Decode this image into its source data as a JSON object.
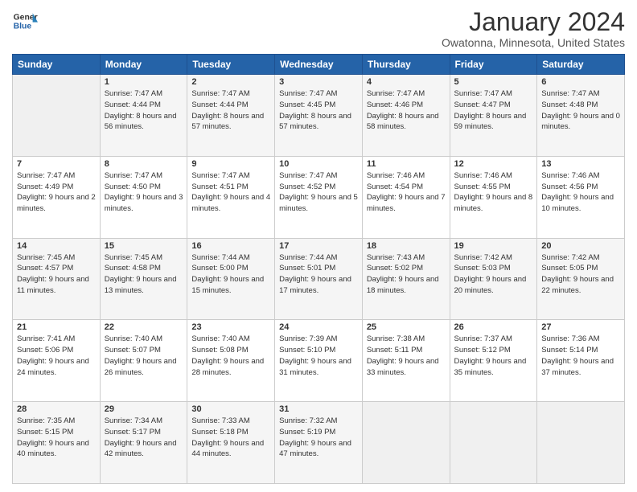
{
  "header": {
    "logo": {
      "general": "General",
      "blue": "Blue",
      "icon_color": "#2563a8"
    },
    "title": "January 2024",
    "subtitle": "Owatonna, Minnesota, United States"
  },
  "calendar": {
    "days_of_week": [
      "Sunday",
      "Monday",
      "Tuesday",
      "Wednesday",
      "Thursday",
      "Friday",
      "Saturday"
    ],
    "weeks": [
      [
        {
          "day": "",
          "sunrise": "",
          "sunset": "",
          "daylight": ""
        },
        {
          "day": "1",
          "sunrise": "Sunrise: 7:47 AM",
          "sunset": "Sunset: 4:44 PM",
          "daylight": "Daylight: 8 hours and 56 minutes."
        },
        {
          "day": "2",
          "sunrise": "Sunrise: 7:47 AM",
          "sunset": "Sunset: 4:44 PM",
          "daylight": "Daylight: 8 hours and 57 minutes."
        },
        {
          "day": "3",
          "sunrise": "Sunrise: 7:47 AM",
          "sunset": "Sunset: 4:45 PM",
          "daylight": "Daylight: 8 hours and 57 minutes."
        },
        {
          "day": "4",
          "sunrise": "Sunrise: 7:47 AM",
          "sunset": "Sunset: 4:46 PM",
          "daylight": "Daylight: 8 hours and 58 minutes."
        },
        {
          "day": "5",
          "sunrise": "Sunrise: 7:47 AM",
          "sunset": "Sunset: 4:47 PM",
          "daylight": "Daylight: 8 hours and 59 minutes."
        },
        {
          "day": "6",
          "sunrise": "Sunrise: 7:47 AM",
          "sunset": "Sunset: 4:48 PM",
          "daylight": "Daylight: 9 hours and 0 minutes."
        }
      ],
      [
        {
          "day": "7",
          "sunrise": "Sunrise: 7:47 AM",
          "sunset": "Sunset: 4:49 PM",
          "daylight": "Daylight: 9 hours and 2 minutes."
        },
        {
          "day": "8",
          "sunrise": "Sunrise: 7:47 AM",
          "sunset": "Sunset: 4:50 PM",
          "daylight": "Daylight: 9 hours and 3 minutes."
        },
        {
          "day": "9",
          "sunrise": "Sunrise: 7:47 AM",
          "sunset": "Sunset: 4:51 PM",
          "daylight": "Daylight: 9 hours and 4 minutes."
        },
        {
          "day": "10",
          "sunrise": "Sunrise: 7:47 AM",
          "sunset": "Sunset: 4:52 PM",
          "daylight": "Daylight: 9 hours and 5 minutes."
        },
        {
          "day": "11",
          "sunrise": "Sunrise: 7:46 AM",
          "sunset": "Sunset: 4:54 PM",
          "daylight": "Daylight: 9 hours and 7 minutes."
        },
        {
          "day": "12",
          "sunrise": "Sunrise: 7:46 AM",
          "sunset": "Sunset: 4:55 PM",
          "daylight": "Daylight: 9 hours and 8 minutes."
        },
        {
          "day": "13",
          "sunrise": "Sunrise: 7:46 AM",
          "sunset": "Sunset: 4:56 PM",
          "daylight": "Daylight: 9 hours and 10 minutes."
        }
      ],
      [
        {
          "day": "14",
          "sunrise": "Sunrise: 7:45 AM",
          "sunset": "Sunset: 4:57 PM",
          "daylight": "Daylight: 9 hours and 11 minutes."
        },
        {
          "day": "15",
          "sunrise": "Sunrise: 7:45 AM",
          "sunset": "Sunset: 4:58 PM",
          "daylight": "Daylight: 9 hours and 13 minutes."
        },
        {
          "day": "16",
          "sunrise": "Sunrise: 7:44 AM",
          "sunset": "Sunset: 5:00 PM",
          "daylight": "Daylight: 9 hours and 15 minutes."
        },
        {
          "day": "17",
          "sunrise": "Sunrise: 7:44 AM",
          "sunset": "Sunset: 5:01 PM",
          "daylight": "Daylight: 9 hours and 17 minutes."
        },
        {
          "day": "18",
          "sunrise": "Sunrise: 7:43 AM",
          "sunset": "Sunset: 5:02 PM",
          "daylight": "Daylight: 9 hours and 18 minutes."
        },
        {
          "day": "19",
          "sunrise": "Sunrise: 7:42 AM",
          "sunset": "Sunset: 5:03 PM",
          "daylight": "Daylight: 9 hours and 20 minutes."
        },
        {
          "day": "20",
          "sunrise": "Sunrise: 7:42 AM",
          "sunset": "Sunset: 5:05 PM",
          "daylight": "Daylight: 9 hours and 22 minutes."
        }
      ],
      [
        {
          "day": "21",
          "sunrise": "Sunrise: 7:41 AM",
          "sunset": "Sunset: 5:06 PM",
          "daylight": "Daylight: 9 hours and 24 minutes."
        },
        {
          "day": "22",
          "sunrise": "Sunrise: 7:40 AM",
          "sunset": "Sunset: 5:07 PM",
          "daylight": "Daylight: 9 hours and 26 minutes."
        },
        {
          "day": "23",
          "sunrise": "Sunrise: 7:40 AM",
          "sunset": "Sunset: 5:08 PM",
          "daylight": "Daylight: 9 hours and 28 minutes."
        },
        {
          "day": "24",
          "sunrise": "Sunrise: 7:39 AM",
          "sunset": "Sunset: 5:10 PM",
          "daylight": "Daylight: 9 hours and 31 minutes."
        },
        {
          "day": "25",
          "sunrise": "Sunrise: 7:38 AM",
          "sunset": "Sunset: 5:11 PM",
          "daylight": "Daylight: 9 hours and 33 minutes."
        },
        {
          "day": "26",
          "sunrise": "Sunrise: 7:37 AM",
          "sunset": "Sunset: 5:12 PM",
          "daylight": "Daylight: 9 hours and 35 minutes."
        },
        {
          "day": "27",
          "sunrise": "Sunrise: 7:36 AM",
          "sunset": "Sunset: 5:14 PM",
          "daylight": "Daylight: 9 hours and 37 minutes."
        }
      ],
      [
        {
          "day": "28",
          "sunrise": "Sunrise: 7:35 AM",
          "sunset": "Sunset: 5:15 PM",
          "daylight": "Daylight: 9 hours and 40 minutes."
        },
        {
          "day": "29",
          "sunrise": "Sunrise: 7:34 AM",
          "sunset": "Sunset: 5:17 PM",
          "daylight": "Daylight: 9 hours and 42 minutes."
        },
        {
          "day": "30",
          "sunrise": "Sunrise: 7:33 AM",
          "sunset": "Sunset: 5:18 PM",
          "daylight": "Daylight: 9 hours and 44 minutes."
        },
        {
          "day": "31",
          "sunrise": "Sunrise: 7:32 AM",
          "sunset": "Sunset: 5:19 PM",
          "daylight": "Daylight: 9 hours and 47 minutes."
        },
        {
          "day": "",
          "sunrise": "",
          "sunset": "",
          "daylight": ""
        },
        {
          "day": "",
          "sunrise": "",
          "sunset": "",
          "daylight": ""
        },
        {
          "day": "",
          "sunrise": "",
          "sunset": "",
          "daylight": ""
        }
      ]
    ]
  }
}
